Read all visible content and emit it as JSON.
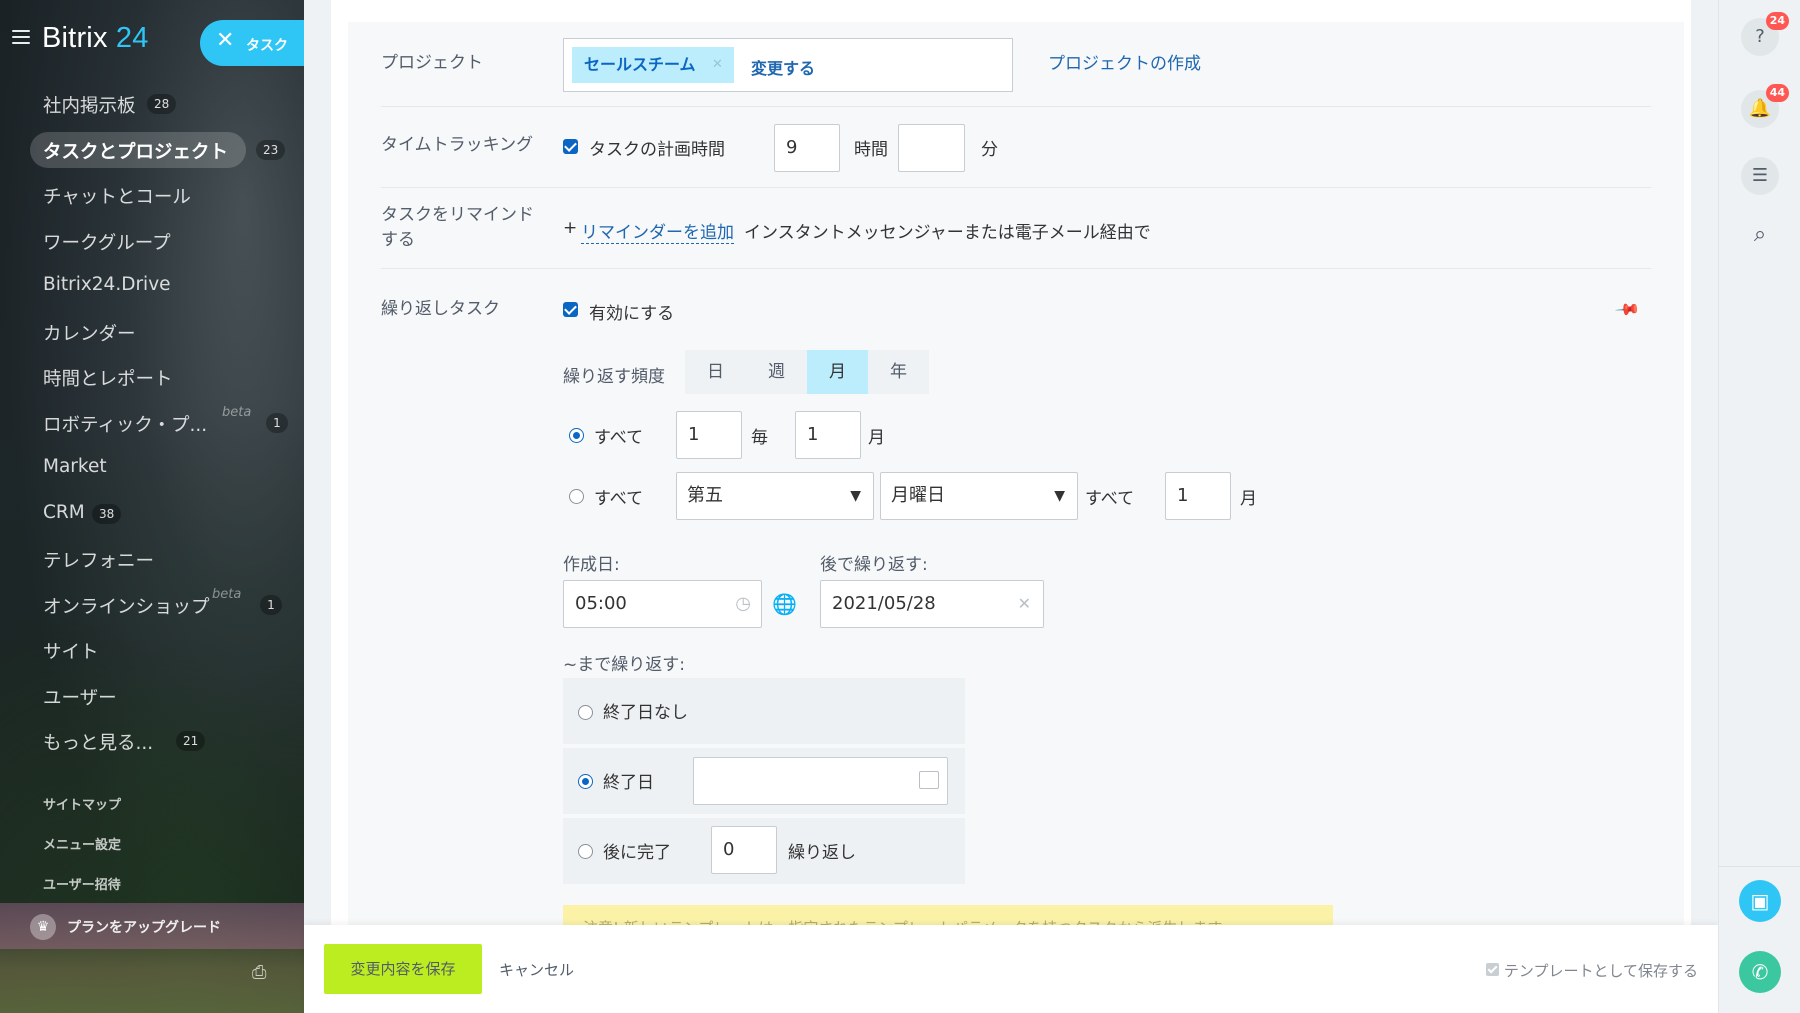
{
  "app": {
    "logo_name": "Bitrix",
    "logo_num": "24",
    "task_pill": "タスク"
  },
  "sidebar": {
    "items": [
      {
        "label": "社内掲示板",
        "count": "28"
      },
      {
        "label": "タスクとプロジェクト",
        "count": "23"
      },
      {
        "label": "チャットとコール"
      },
      {
        "label": "ワークグループ"
      },
      {
        "label": "Bitrix24.Drive"
      },
      {
        "label": "カレンダー"
      },
      {
        "label": "時間とレポート"
      },
      {
        "label": "ロボティック・プ...",
        "beta": "beta",
        "count": "1"
      },
      {
        "label": "Market"
      },
      {
        "label": "CRM",
        "count": "38"
      },
      {
        "label": "テレフォニー"
      },
      {
        "label": "オンラインショップ",
        "beta": "beta",
        "count": "1"
      },
      {
        "label": "サイト"
      },
      {
        "label": "ユーザー"
      },
      {
        "label": "もっと見る...",
        "count": "21"
      }
    ],
    "sitemap": "サイトマップ",
    "menu_settings": "メニュー設定",
    "invite": "ユーザー招待",
    "upgrade": "プランをアップグレード"
  },
  "form": {
    "project": {
      "label": "プロジェクト",
      "tag": "セールスチーム",
      "change": "変更する",
      "create": "プロジェクトの作成"
    },
    "time_tracking": {
      "label": "タイムトラッキング",
      "checkbox_label": "タスクの計画時間",
      "hours_value": "9",
      "hours_unit": "時間",
      "minutes_value": "",
      "minutes_unit": "分"
    },
    "reminder": {
      "label_line1": "タスクをリマインド",
      "label_line2": "する",
      "plus": "+",
      "add_link": "リマインダーを追加",
      "hint": "インスタントメッセンジャーまたは電子メール経由で"
    },
    "repeat": {
      "label": "繰り返しタスク",
      "enable": "有効にする",
      "freq_label": "繰り返す頻度",
      "freq_tabs": [
        "日",
        "週",
        "月",
        "年"
      ],
      "freq_active": "月",
      "row1": {
        "every": "すべて",
        "day_value": "1",
        "each": "毎",
        "month_value": "1",
        "month_unit": "月"
      },
      "row2": {
        "every": "すべて",
        "ordinal": "第五",
        "weekday": "月曜日",
        "every2": "すべて",
        "month_value": "1",
        "month_unit": "月"
      },
      "created_label": "作成日:",
      "created_time": "05:00",
      "start_label": "後で繰り返す:",
      "start_date": "2021/05/28",
      "until_label": "~まで繰り返す:",
      "no_end": "終了日なし",
      "end_date": "終了日",
      "end_date_value": "",
      "after": "後に完了",
      "after_value": "0",
      "after_unit": "繰り返し",
      "notice": "注意! 新しいテンプレートは、指定されたテンプレートパラメータを持つタスクから派生します"
    }
  },
  "footer": {
    "save": "変更内容を保存",
    "cancel": "キャンセル",
    "save_template": "テンプレートとして保存する"
  },
  "rightbar": {
    "help_badge": "24",
    "notify_badge": "44"
  },
  "colors": {
    "accent": "#2fc6f6",
    "link": "#2067b0",
    "save_button": "#bbed21",
    "tag_bg": "#bcedfc",
    "badge": "#ff5752"
  }
}
